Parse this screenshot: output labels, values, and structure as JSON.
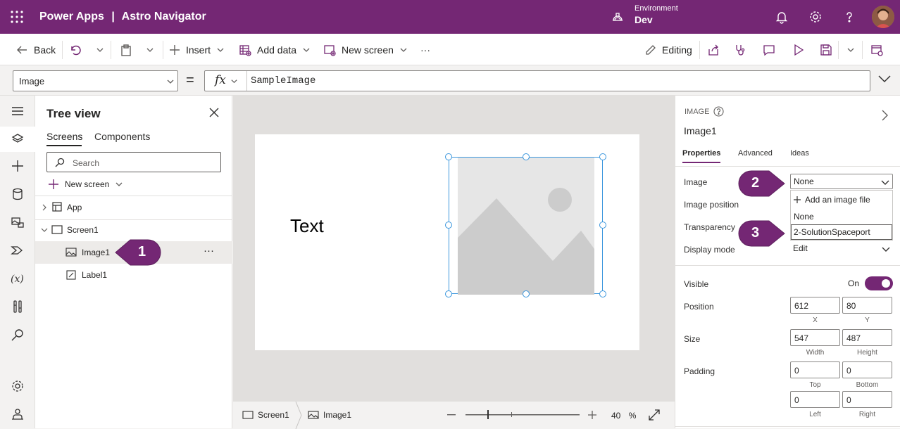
{
  "topbar": {
    "product": "Power Apps",
    "separator": "|",
    "app_name": "Astro Navigator",
    "env_label": "Environment",
    "env_value": "Dev",
    "bg_color": "#742774"
  },
  "commands": {
    "back": "Back",
    "insert": "Insert",
    "add_data": "Add data",
    "new_screen": "New screen",
    "more": "···",
    "editing": "Editing"
  },
  "formula": {
    "property": "Image",
    "equals": "=",
    "fx": "fx",
    "value": "SampleImage"
  },
  "tree": {
    "title": "Tree view",
    "tabs": [
      "Screens",
      "Components"
    ],
    "search_placeholder": "Search",
    "new_screen": "New screen",
    "items": [
      {
        "label": "App",
        "icon": "app-icon"
      },
      {
        "label": "Screen1",
        "icon": "screen-icon"
      },
      {
        "label": "Image1",
        "icon": "image-icon",
        "selected": true,
        "more": "···"
      },
      {
        "label": "Label1",
        "icon": "label-icon"
      }
    ]
  },
  "canvas": {
    "text_label": "Text"
  },
  "bottombar": {
    "crumb_screen": "Screen1",
    "crumb_control": "Image1",
    "zoom_value": "40",
    "zoom_unit": "%"
  },
  "props": {
    "control_type": "IMAGE",
    "control_name": "Image1",
    "tabs": [
      "Properties",
      "Advanced",
      "Ideas"
    ],
    "image_label": "Image",
    "image_value": "None",
    "image_position_label": "Image position",
    "transparency_label": "Transparency",
    "display_mode_label": "Display mode",
    "display_mode_value": "Edit",
    "dropdown_options": [
      "Add an image file",
      "None",
      "2-SolutionSpaceport"
    ],
    "visible_label": "Visible",
    "visible_state": "On",
    "position_label": "Position",
    "position_x": "612",
    "position_y": "80",
    "x_label": "X",
    "y_label": "Y",
    "size_label": "Size",
    "width_value": "547",
    "height_value": "487",
    "width_label": "Width",
    "height_label": "Height",
    "padding_label": "Padding",
    "padding_top": "0",
    "padding_bottom": "0",
    "padding_left": "0",
    "padding_right": "0",
    "top_label": "Top",
    "bottom_label": "Bottom",
    "left_label": "Left",
    "right_label": "Right"
  },
  "callouts": [
    "1",
    "2",
    "3"
  ],
  "colors": {
    "accent": "#742774",
    "selection": "#3a96dd"
  }
}
